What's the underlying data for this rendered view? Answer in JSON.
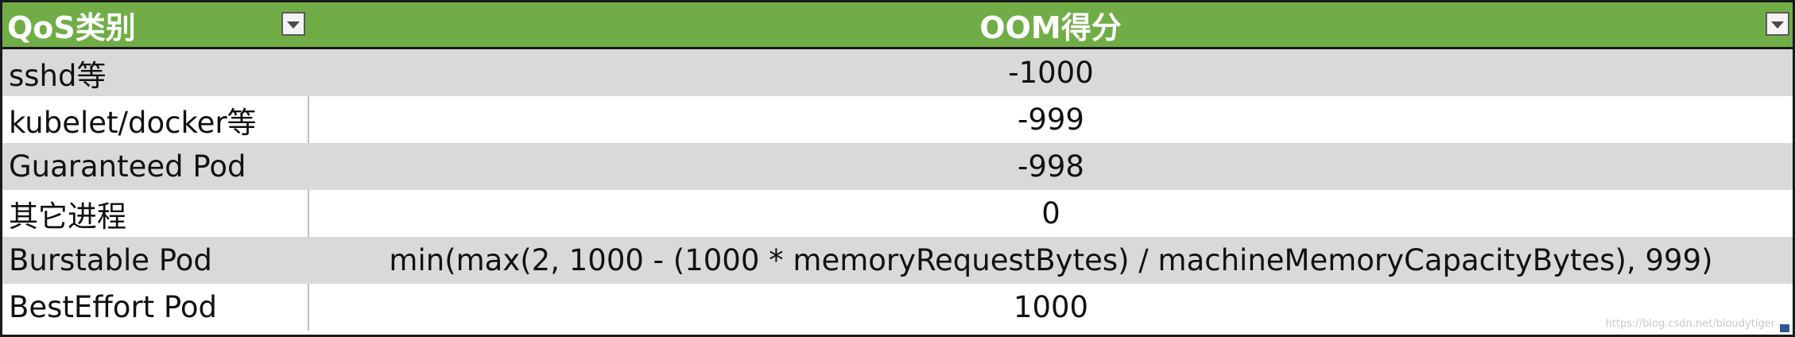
{
  "table": {
    "headers": {
      "qos": "QoS类别",
      "oom": "OOM得分"
    },
    "filter_icon": "dropdown-arrow-icon",
    "rows": [
      {
        "qos": "sshd等",
        "oom": "-1000"
      },
      {
        "qos": "kubelet/docker等",
        "oom": "-999"
      },
      {
        "qos": "Guaranteed Pod",
        "oom": "-998"
      },
      {
        "qos": "其它进程",
        "oom": "0"
      },
      {
        "qos": "Burstable Pod",
        "oom": "min(max(2, 1000 - (1000 * memoryRequestBytes) / machineMemoryCapacityBytes), 999)"
      },
      {
        "qos": "BestEffort Pod",
        "oom": "1000"
      }
    ]
  },
  "watermark": "https://blog.csdn.net/bloudytiger",
  "colors": {
    "header_bg": "#70ad47",
    "header_text": "#ffffff",
    "band_row": "#d9d9d9",
    "plain_row": "#ffffff"
  }
}
